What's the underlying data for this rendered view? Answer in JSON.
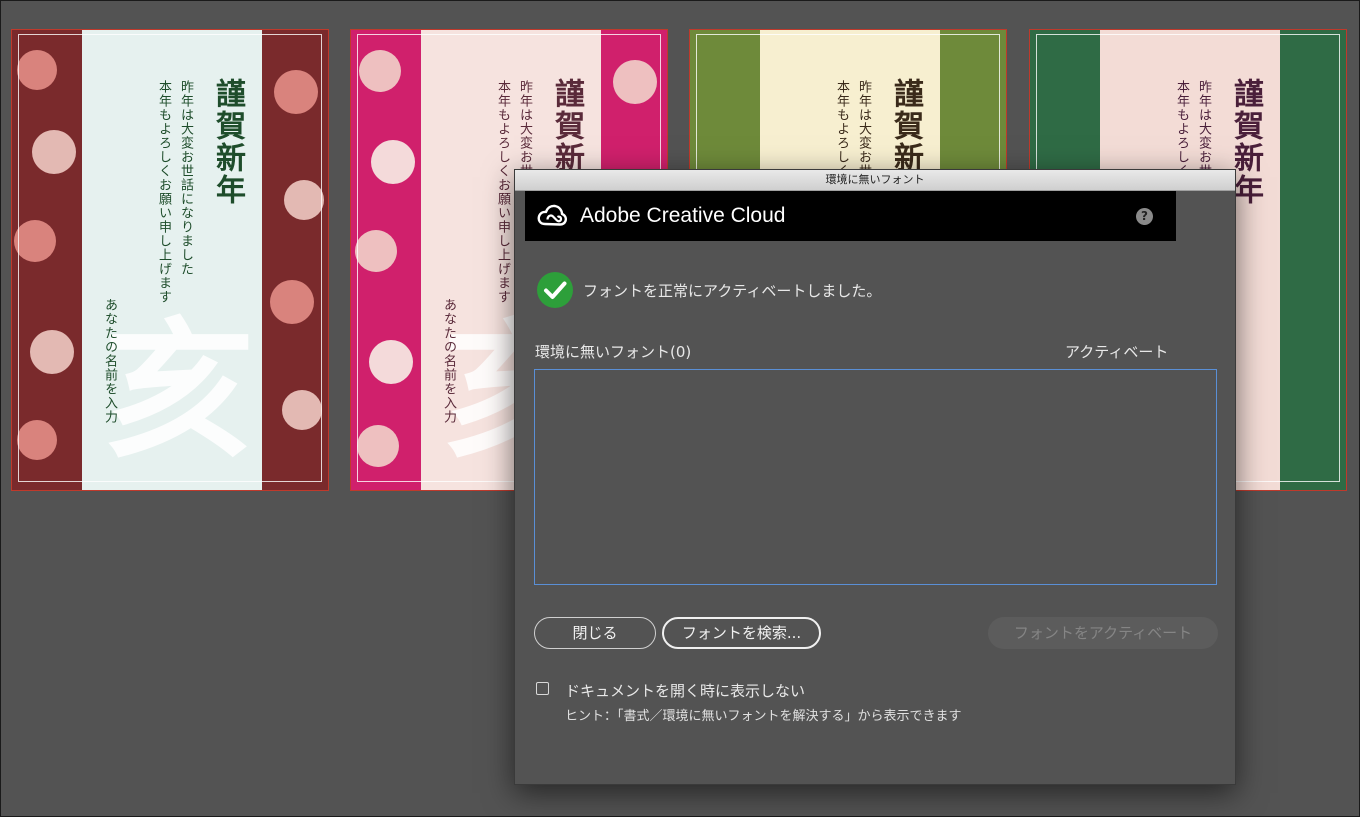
{
  "cards": [
    {
      "title": "謹賀新年",
      "message_line1": "昨年は大変お世話になりました",
      "message_line2": "本年もよろしくお願い申し上げます",
      "name": "あなたの名前を入力",
      "big_kanji": "亥",
      "colors": {
        "side": "#7a2a2c",
        "center": "#e6f1ef",
        "text": "#1e4d2b",
        "flower": "#d9837d"
      }
    },
    {
      "title": "謹賀新",
      "message_line1": "昨年は大変お世話",
      "message_line2": "本年もよろしくお願い申し上げます",
      "name": "あなたの名前を入力",
      "big_kanji": "亥",
      "colors": {
        "side": "#d0206c",
        "center": "#f6e3df",
        "text": "#5a2a3a",
        "flower": "#eec0c0"
      }
    },
    {
      "title": "謹賀新",
      "message_line1": "昨年は大変お世",
      "message_line2": "本年もよろしく",
      "colors": {
        "side": "#6e8a3a",
        "center": "#f7efd0",
        "text": "#3a2a1a",
        "flower": "#c9b98a"
      }
    },
    {
      "title": "謹賀新年",
      "message_line1": "昨年は大変お世",
      "message_line2": "本年もよろしく",
      "colors": {
        "side": "#2f6b45",
        "center": "#f3dcd6",
        "text": "#4a1f3a",
        "flower": "#e7a7a0"
      }
    }
  ],
  "dialog": {
    "window_title": "環境に無いフォント",
    "header_title": "Adobe Creative Cloud",
    "help_label": "?",
    "success_message": "フォントを正常にアクティベートしました。",
    "missing_fonts_label": "環境に無いフォント(0)",
    "activate_column": "アクティベート",
    "close_button": "閉じる",
    "find_fonts_button": "フォントを検索...",
    "activate_fonts_button": "フォントをアクティベート",
    "dont_show_label": "ドキュメントを開く時に表示しない",
    "hint": "ヒント：「書式／環境に無いフォントを解決する」から表示できます"
  },
  "icons": {
    "cc_logo": "creative-cloud-icon",
    "success": "checkmark-circle-icon",
    "help": "help-icon"
  }
}
